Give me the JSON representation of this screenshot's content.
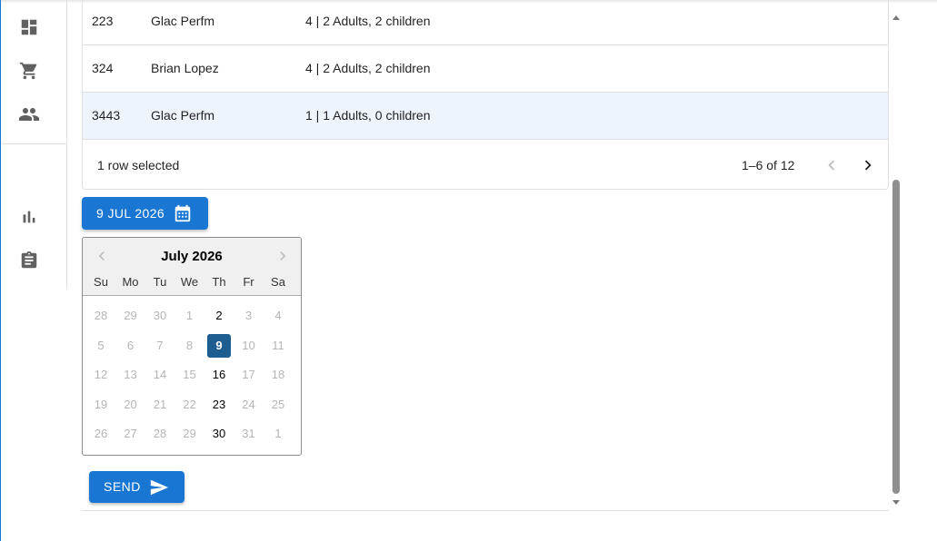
{
  "sidebar": {
    "items": [
      {
        "icon": "dashboard-icon"
      },
      {
        "icon": "shopping-cart-icon"
      },
      {
        "icon": "people-icon"
      },
      {
        "icon": "bar-chart-icon"
      },
      {
        "icon": "assignment-icon"
      }
    ]
  },
  "grid": {
    "rows": [
      {
        "id": "223",
        "name": "Glac Perfm",
        "guests": "4 | 2 Adults, 2 children",
        "selected": false
      },
      {
        "id": "324",
        "name": "Brian Lopez",
        "guests": "4 | 2 Adults, 2 children",
        "selected": false
      },
      {
        "id": "3443",
        "name": "Glac Perfm",
        "guests": "1 | 1 Adults, 0 children",
        "selected": true
      }
    ],
    "footer": {
      "selection": "1 row selected",
      "pagination": "1–6 of 12"
    }
  },
  "date_button": {
    "label": "9 JUL 2026",
    "icon": "calendar-icon"
  },
  "calendar": {
    "title": "July 2026",
    "weekdays": [
      "Su",
      "Mo",
      "Tu",
      "We",
      "Th",
      "Fr",
      "Sa"
    ],
    "weeks": [
      [
        "28",
        "29",
        "30",
        "1",
        "2",
        "3",
        "4"
      ],
      [
        "5",
        "6",
        "7",
        "8",
        "9",
        "10",
        "11"
      ],
      [
        "12",
        "13",
        "14",
        "15",
        "16",
        "17",
        "18"
      ],
      [
        "19",
        "20",
        "21",
        "22",
        "23",
        "24",
        "25"
      ],
      [
        "26",
        "27",
        "28",
        "29",
        "30",
        "31",
        "1"
      ]
    ],
    "enabled_days": [
      "2",
      "9",
      "16",
      "23",
      "30"
    ],
    "selected_day": "9"
  },
  "send_button": {
    "label": "SEND",
    "icon": "send-icon"
  },
  "colors": {
    "primary": "#1976d2",
    "selected_row": "#edf4fc",
    "selected_day": "#1d5d90"
  }
}
